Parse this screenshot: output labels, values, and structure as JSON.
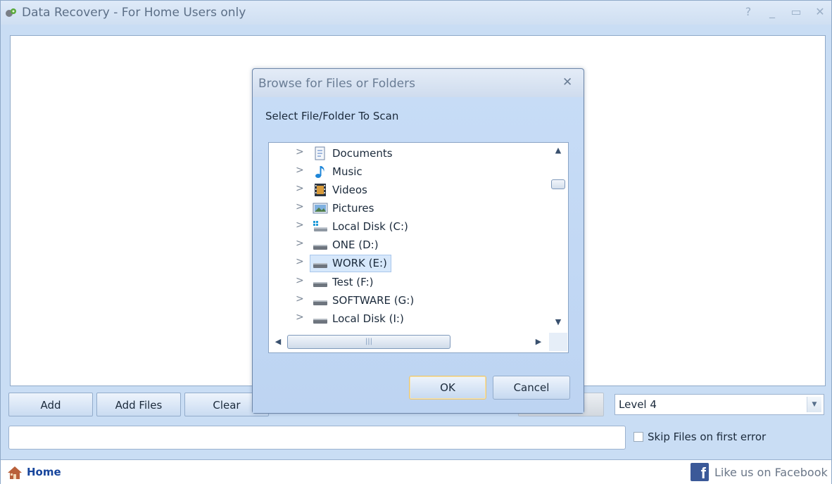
{
  "window": {
    "title": "Data Recovery - For Home Users only",
    "controls": {
      "help": "?",
      "minimize": "_",
      "maximize": "▭",
      "close": "✕"
    }
  },
  "toolbar": {
    "buttons": [
      {
        "label": "Add"
      },
      {
        "label": "Add Files"
      },
      {
        "label": "Clear"
      }
    ],
    "level_select": {
      "value": "Level 4"
    },
    "path_input": {
      "value": ""
    },
    "skip_files": {
      "label": "Skip Files on first error",
      "checked": false
    }
  },
  "footer": {
    "home_label": "Home",
    "facebook_label": "Like us on Facebook"
  },
  "dialog": {
    "title": "Browse for Files or Folders",
    "close": "✕",
    "prompt": "Select File/Folder To Scan",
    "tree_items": [
      {
        "label": "Documents",
        "icon": "documents-icon"
      },
      {
        "label": "Music",
        "icon": "music-icon"
      },
      {
        "label": "Videos",
        "icon": "videos-icon"
      },
      {
        "label": "Pictures",
        "icon": "pictures-icon"
      },
      {
        "label": "Local Disk (C:)",
        "icon": "system-drive-icon"
      },
      {
        "label": "ONE (D:)",
        "icon": "drive-icon"
      },
      {
        "label": "WORK (E:)",
        "icon": "drive-icon",
        "selected": true
      },
      {
        "label": "Test (F:)",
        "icon": "drive-icon"
      },
      {
        "label": "SOFTWARE (G:)",
        "icon": "drive-icon"
      },
      {
        "label": "Local Disk (I:)",
        "icon": "drive-icon"
      }
    ],
    "ok_label": "OK",
    "cancel_label": "Cancel"
  },
  "colors": {
    "window_bg": "#c9ddf4",
    "selection": "#d7e8fb",
    "link": "#17459c",
    "facebook": "#3b5998"
  }
}
